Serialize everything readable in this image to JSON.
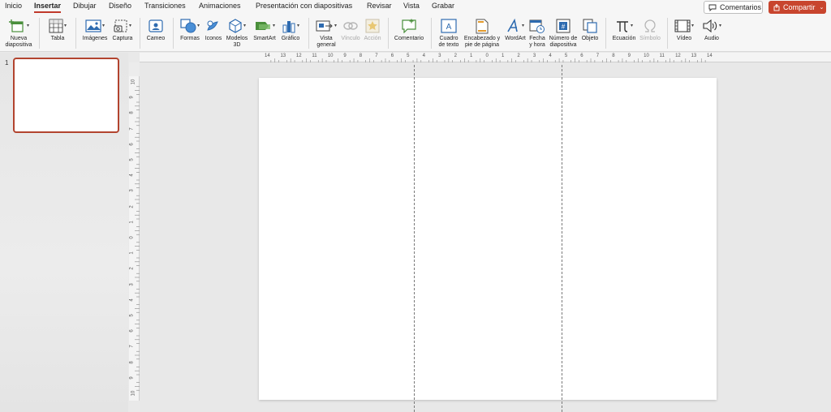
{
  "tabs": [
    {
      "label": "Inicio",
      "active": false
    },
    {
      "label": "Insertar",
      "active": true
    },
    {
      "label": "Dibujar",
      "active": false
    },
    {
      "label": "Diseño",
      "active": false
    },
    {
      "label": "Transiciones",
      "active": false
    },
    {
      "label": "Animaciones",
      "active": false
    },
    {
      "label": "Presentación con diapositivas",
      "active": false
    },
    {
      "label": "Revisar",
      "active": false
    },
    {
      "label": "Vista",
      "active": false
    },
    {
      "label": "Grabar",
      "active": false
    }
  ],
  "header": {
    "comments_label": "Comentarios",
    "share_label": "Compartir"
  },
  "ribbon": {
    "new_slide": "Nueva\ndiapositiva",
    "table": "Tabla",
    "images": "Imágenes",
    "capture": "Captura",
    "cameo": "Cameo",
    "shapes": "Formas",
    "icons": "Iconos",
    "models3d": "Modelos\n3D",
    "smartart": "SmartArt",
    "chart": "Gráfico",
    "overview": "Vista\ngeneral",
    "link": "Vínculo",
    "action": "Acción",
    "comment": "Comentario",
    "textbox": "Cuadro\nde texto",
    "header_footer": "Encabezado y\npie de página",
    "wordart": "WordArt",
    "datetime": "Fecha\ny hora",
    "slide_number": "Número de\ndiapositiva",
    "object": "Objeto",
    "equation": "Ecuación",
    "symbol": "Símbolo",
    "video": "Vídeo",
    "audio": "Audio"
  },
  "thumbnails": {
    "slide_number": "1"
  },
  "rulers": {
    "horizontal": [
      "14",
      "13",
      "12",
      "11",
      "10",
      "9",
      "8",
      "7",
      "6",
      "5",
      "4",
      "3",
      "2",
      "1",
      "0",
      "1",
      "2",
      "3",
      "4",
      "5",
      "6",
      "7",
      "8",
      "9",
      "10",
      "11",
      "12",
      "13",
      "14"
    ],
    "vertical": [
      "10",
      "9",
      "8",
      "7",
      "6",
      "5",
      "4",
      "3",
      "2",
      "1",
      "0",
      "1",
      "2",
      "3",
      "4",
      "5",
      "6",
      "7",
      "8",
      "9",
      "10"
    ]
  },
  "colors": {
    "accent": "#c0392b",
    "share_button": "#c8452e",
    "thumbnail_border": "#b2442f"
  }
}
